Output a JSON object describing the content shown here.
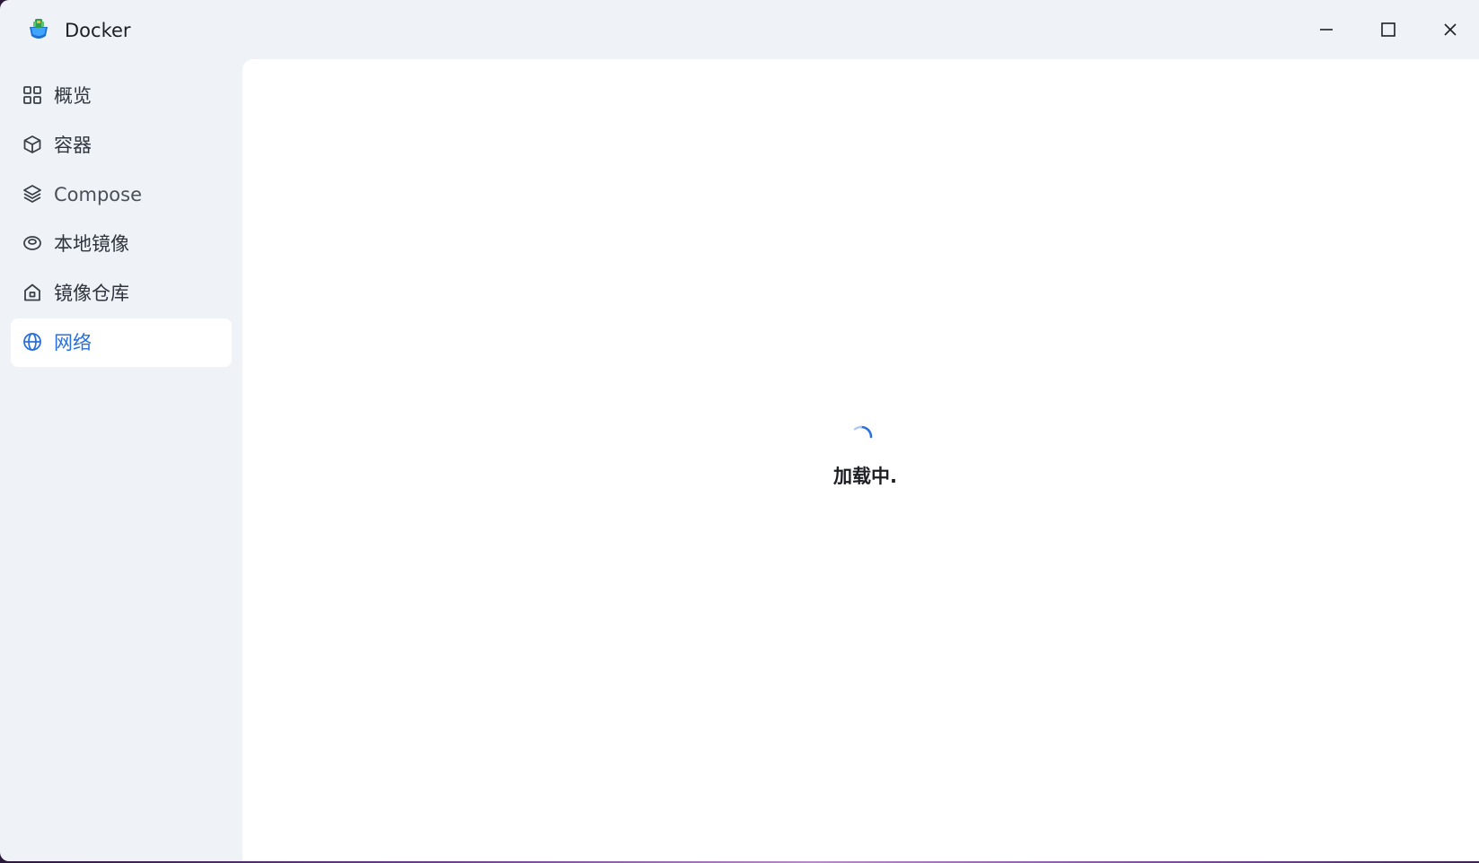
{
  "window": {
    "title": "Docker",
    "icon": "docker-app-icon",
    "controls": {
      "minimize_icon": "minimize-icon",
      "maximize_icon": "maximize-icon",
      "close_icon": "close-icon"
    }
  },
  "sidebar": {
    "items": [
      {
        "label": "概览",
        "icon": "grid-icon",
        "active": false
      },
      {
        "label": "容器",
        "icon": "cube-icon",
        "active": false
      },
      {
        "label": "Compose",
        "icon": "layers-icon",
        "active": false
      },
      {
        "label": "本地镜像",
        "icon": "disk-icon",
        "active": false
      },
      {
        "label": "镜像仓库",
        "icon": "home-icon",
        "active": false
      },
      {
        "label": "网络",
        "icon": "globe-icon",
        "active": true
      }
    ]
  },
  "main": {
    "loading_text": "加载中."
  },
  "colors": {
    "accent": "#2a6fdb",
    "sidebar_bg": "#eff3f8",
    "content_bg": "#ffffff",
    "text": "#2f343d"
  }
}
